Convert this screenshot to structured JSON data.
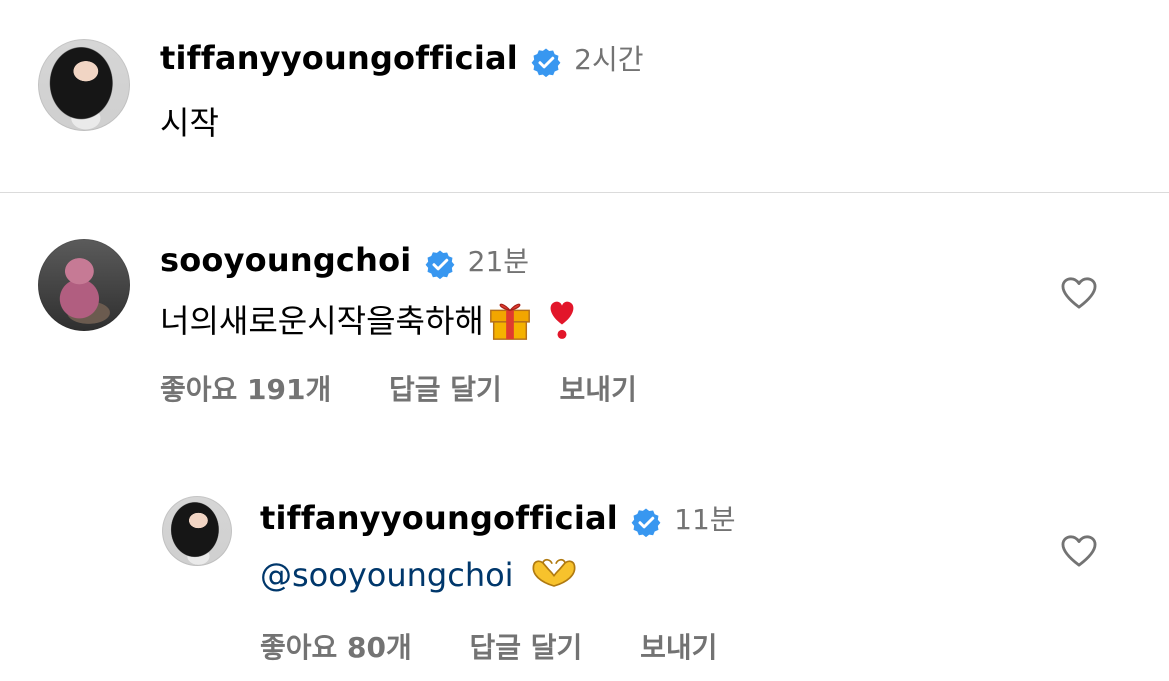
{
  "caption": {
    "username": "tiffanyyoungofficial",
    "time": "2시간",
    "text": "시작"
  },
  "comment1": {
    "username": "sooyoungchoi",
    "time": "21분",
    "text": "너의새로운시작을축하해",
    "emojis": [
      "gift-emoji",
      "heart-exclamation-emoji"
    ],
    "likes_label": "좋아요 191개",
    "reply_label": "답글 달기",
    "send_label": "보내기"
  },
  "reply1": {
    "username": "tiffanyyoungofficial",
    "time": "11분",
    "mention": "@sooyoungchoi",
    "emojis": [
      "heart-hands-emoji"
    ],
    "likes_label": "좋아요 80개",
    "reply_label": "답글 달기",
    "send_label": "보내기"
  },
  "colors": {
    "verified": "#3897f0",
    "mention": "#00376b",
    "secondary_text": "#737373",
    "divider": "#dbdbdb"
  }
}
